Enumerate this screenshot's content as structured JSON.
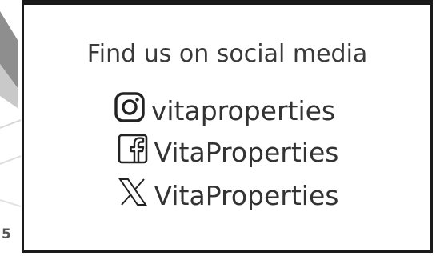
{
  "background": {
    "page_number": "5"
  },
  "card": {
    "title": "Find us on social media",
    "border_color": "#1a1a1a",
    "text_color": "#333333",
    "links": [
      {
        "platform": "instagram",
        "icon": "instagram-icon",
        "label": "vitaproperties"
      },
      {
        "platform": "facebook",
        "icon": "facebook-icon",
        "label": "VitaProperties"
      },
      {
        "platform": "x",
        "icon": "x-logo-icon",
        "label": "VitaProperties"
      }
    ]
  }
}
